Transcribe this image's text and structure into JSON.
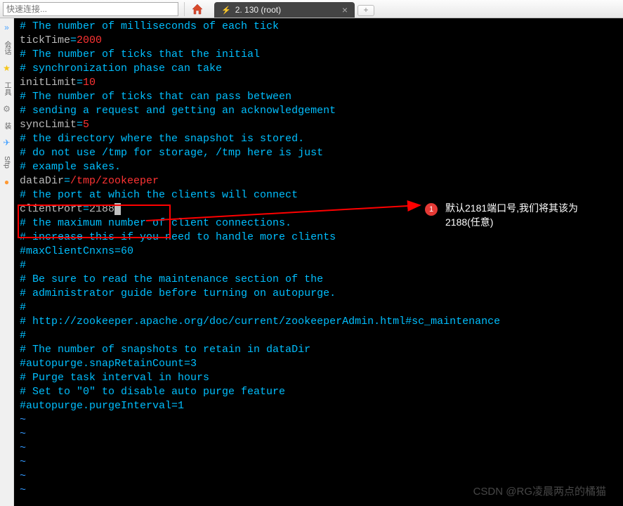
{
  "toolbar": {
    "quick_connect_placeholder": "快速连接...",
    "tab_label": "2. 130  (root)",
    "tab_add": "+"
  },
  "sidebar": {
    "items": [
      "会话",
      "工具",
      "装",
      "Sftp"
    ],
    "arrow_icon": "»"
  },
  "annotation": {
    "badge": "1",
    "text_line1": "默认2181端口号,我们将其该为",
    "text_line2": "2188(任意)"
  },
  "terminal": {
    "lines": [
      {
        "t": "comment",
        "v": "# The number of milliseconds of each tick"
      },
      {
        "t": "kv",
        "k": "tickTime",
        "eq": "=",
        "v": "2000",
        "vc": "red"
      },
      {
        "t": "comment",
        "v": "# The number of ticks that the initial "
      },
      {
        "t": "comment",
        "v": "# synchronization phase can take"
      },
      {
        "t": "kv",
        "k": "initLimit",
        "eq": "=",
        "v": "10",
        "vc": "red"
      },
      {
        "t": "comment",
        "v": "# The number of ticks that can pass between "
      },
      {
        "t": "comment",
        "v": "# sending a request and getting an acknowledgement"
      },
      {
        "t": "kv",
        "k": "syncLimit",
        "eq": "=",
        "v": "5",
        "vc": "red"
      },
      {
        "t": "comment",
        "v": "# the directory where the snapshot is stored."
      },
      {
        "t": "comment",
        "v": "# do not use /tmp for storage, /tmp here is just "
      },
      {
        "t": "comment",
        "v": "# example sakes."
      },
      {
        "t": "kv",
        "k": "dataDir",
        "eq": "=",
        "v": "/tmp/zookeeper",
        "vc": "red"
      },
      {
        "t": "comment",
        "v": "# the port at which the clients will connect"
      },
      {
        "t": "kv",
        "k": "clientPort",
        "eq": "=",
        "v": "2188",
        "cursor": true
      },
      {
        "t": "comment",
        "v": "# the maximum number of client connections."
      },
      {
        "t": "comment",
        "v": "# increase this if you need to handle more clients"
      },
      {
        "t": "comment",
        "v": "#maxClientCnxns=60"
      },
      {
        "t": "comment",
        "v": "#"
      },
      {
        "t": "comment",
        "v": "# Be sure to read the maintenance section of the "
      },
      {
        "t": "comment",
        "v": "# administrator guide before turning on autopurge."
      },
      {
        "t": "comment",
        "v": "#"
      },
      {
        "t": "comment",
        "v": "# http://zookeeper.apache.org/doc/current/zookeeperAdmin.html#sc_maintenance"
      },
      {
        "t": "comment",
        "v": "#"
      },
      {
        "t": "comment",
        "v": "# The number of snapshots to retain in dataDir"
      },
      {
        "t": "comment",
        "v": "#autopurge.snapRetainCount=3"
      },
      {
        "t": "comment",
        "v": "# Purge task interval in hours"
      },
      {
        "t": "comment",
        "v": "# Set to \"0\" to disable auto purge feature"
      },
      {
        "t": "comment",
        "v": "#autopurge.purgeInterval=1"
      },
      {
        "t": "tilde",
        "v": "~                                                                                                   "
      },
      {
        "t": "tilde",
        "v": "~                                                                                                   "
      },
      {
        "t": "tilde",
        "v": "~                                                                                                   "
      },
      {
        "t": "tilde",
        "v": "~                                                                                                   "
      },
      {
        "t": "tilde",
        "v": "~                                                                                                   "
      },
      {
        "t": "tilde",
        "v": "~                                                                                                   "
      }
    ]
  },
  "watermark": "CSDN @RG​凌晨两点的橘猫"
}
